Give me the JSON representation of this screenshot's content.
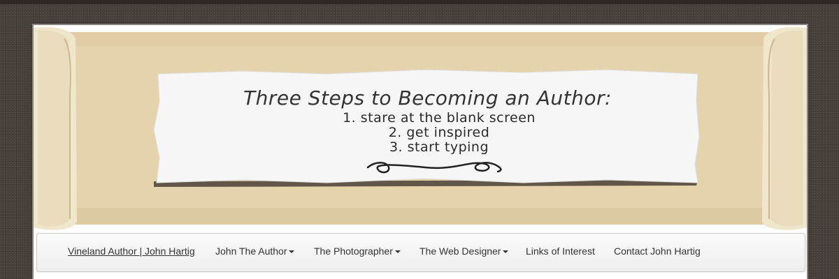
{
  "banner": {
    "title": "Three Steps to Becoming an Author:",
    "steps": [
      "1. stare at the blank screen",
      "2. get inspired",
      "3. start typing"
    ]
  },
  "nav": {
    "brand": "Vineland Author | John Hartig",
    "items": [
      {
        "label": "John The Author",
        "has_dropdown": true
      },
      {
        "label": "The Photographer",
        "has_dropdown": true
      },
      {
        "label": "The Web Designer",
        "has_dropdown": true
      },
      {
        "label": "Links of Interest",
        "has_dropdown": false
      },
      {
        "label": "Contact John Hartig",
        "has_dropdown": false
      }
    ]
  },
  "colors": {
    "background": "#4a433d",
    "parchment": "#e5d3ad",
    "paper": "#f6f6f6",
    "navbar": "#f5f5f5",
    "text": "#333333"
  }
}
